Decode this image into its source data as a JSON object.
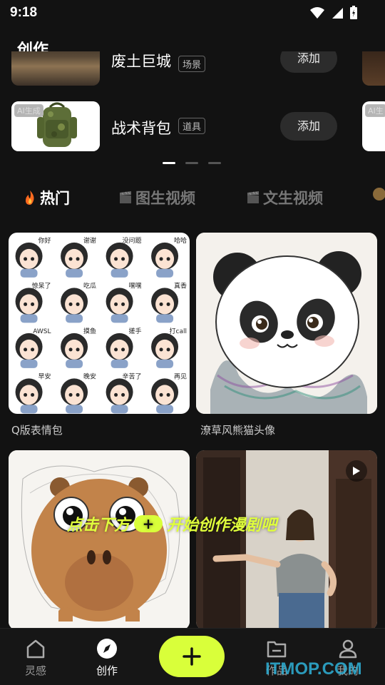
{
  "status": {
    "time": "9:18"
  },
  "header": {
    "title": "创作"
  },
  "assets": [
    {
      "name": "废土巨城",
      "tag": "场景",
      "add_label": "添加",
      "badge": ""
    },
    {
      "name": "战术背包",
      "tag": "道具",
      "add_label": "添加",
      "badge": "AI生成"
    }
  ],
  "edge_badge": "AI生",
  "carousel": {
    "pages": 3,
    "active": 0
  },
  "tabs": [
    {
      "label": "热门",
      "icon": "fire-icon",
      "active": true
    },
    {
      "label": "图生视频",
      "icon": "clapperboard-icon",
      "active": false
    },
    {
      "label": "文生视频",
      "icon": "clapperboard-icon",
      "active": false
    }
  ],
  "cards": [
    {
      "caption": "Q版表情包",
      "type": "image"
    },
    {
      "caption": "潦草风熊猫头像",
      "type": "image"
    },
    {
      "caption": "",
      "type": "image"
    },
    {
      "caption": "",
      "type": "video"
    }
  ],
  "sticker_texts": [
    "你好",
    "谢谢",
    "没问题",
    "哈哈",
    "惊呆了",
    "吃瓜",
    "嘿嘿",
    "真香",
    "AWSL",
    "摸鱼",
    "搓手",
    "打call",
    "早安",
    "晚安",
    "辛苦了",
    "再见"
  ],
  "banner": {
    "before": "点击下方",
    "plus": "+",
    "after": "开始创作漫剧吧"
  },
  "nav": [
    {
      "label": "灵感",
      "icon": "home-icon",
      "active": false
    },
    {
      "label": "创作",
      "icon": "compass-icon",
      "active": true
    },
    {
      "label": "作品",
      "icon": "folder-icon",
      "active": false
    },
    {
      "label": "我的",
      "icon": "user-icon",
      "active": false
    }
  ],
  "watermark": "ITMOP.COM",
  "colors": {
    "accent": "#d9ff3a",
    "background": "#121212"
  }
}
